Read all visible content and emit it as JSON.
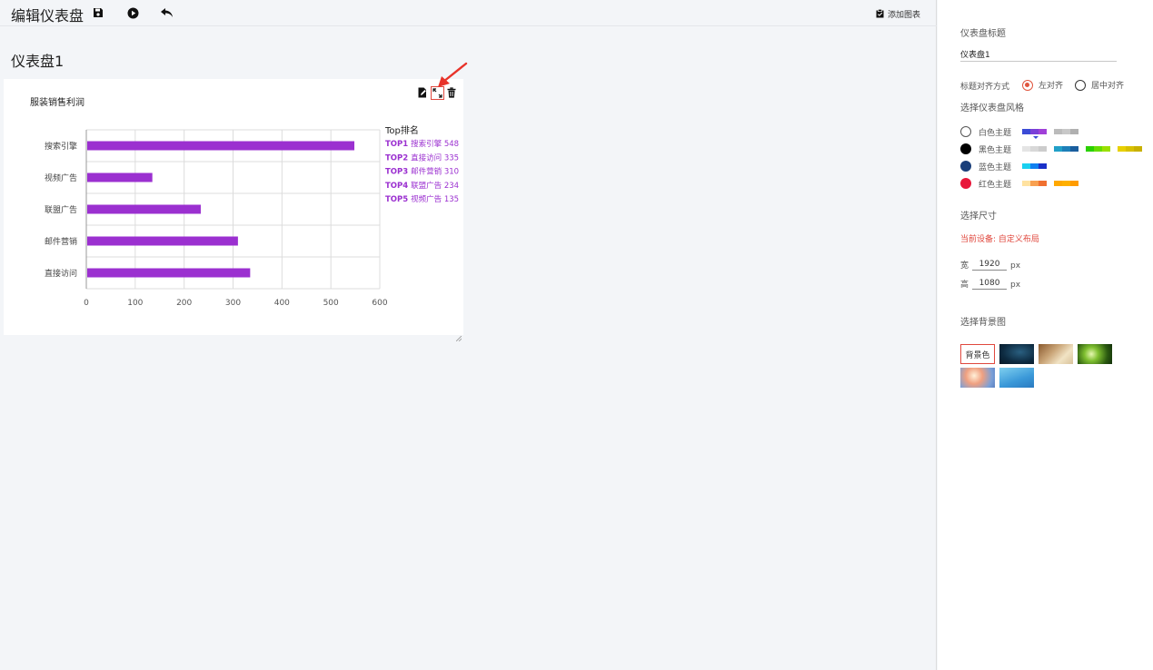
{
  "header": {
    "title": "编辑仪表盘",
    "add_chart_label": "添加图表"
  },
  "dashboard": {
    "title": "仪表盘1"
  },
  "chart_data": {
    "type": "bar",
    "orientation": "horizontal",
    "title": "服装销售利润",
    "categories": [
      "搜索引擎",
      "视频广告",
      "联盟广告",
      "邮件营销",
      "直接访问"
    ],
    "values": [
      548,
      135,
      234,
      310,
      335
    ],
    "xlim": [
      0,
      600
    ],
    "xticks": [
      0,
      100,
      200,
      300,
      400,
      500,
      600
    ],
    "grid": true,
    "bar_color": "#9b30d0",
    "legend": {
      "title": "Top排名",
      "placement": "right",
      "items": [
        {
          "rank": "TOP1",
          "text": "搜索引擎 548"
        },
        {
          "rank": "TOP2",
          "text": "直接访问 335"
        },
        {
          "rank": "TOP3",
          "text": "邮件营销 310"
        },
        {
          "rank": "TOP4",
          "text": "联盟广告 234"
        },
        {
          "rank": "TOP5",
          "text": "视频广告 135"
        }
      ]
    }
  },
  "panel": {
    "title_label": "仪表盘标题",
    "title_value": "仪表盘1",
    "align_label": "标题对齐方式",
    "align_options": [
      "左对齐",
      "居中对齐"
    ],
    "align_selected": "左对齐",
    "style_label": "选择仪表盘风格",
    "themes": [
      {
        "name": "白色主题",
        "dot": "#ffffff",
        "swatches": [
          [
            "#3b4bd6",
            "#7a3fd8",
            "#a040d8"
          ],
          [
            "#bbbbbb",
            "#c8c8c8",
            "#b0b0b0"
          ]
        ]
      },
      {
        "name": "黑色主题",
        "dot": "#000000",
        "swatches": [
          [
            "#e4e4e4",
            "#d8d8d8",
            "#cccccc"
          ],
          [
            "#22a0c8",
            "#1d7fb8",
            "#1a5e9e"
          ],
          [
            "#2bd000",
            "#66dd00",
            "#9ae000"
          ],
          [
            "#e8d000",
            "#d8c000",
            "#c8b000"
          ]
        ]
      },
      {
        "name": "蓝色主题",
        "dot": "#1a3f7a",
        "swatches": [
          [
            "#1ad0f0",
            "#1080f0",
            "#1a30c8"
          ]
        ]
      },
      {
        "name": "红色主题",
        "dot": "#e8173a",
        "swatches": [
          [
            "#ffe2a0",
            "#f8a050",
            "#f07030"
          ],
          [
            "#ffa800",
            "#ffb000",
            "#ff9c00"
          ]
        ]
      }
    ],
    "size_label": "选择尺寸",
    "device_info": "当前设备: 自定义布局",
    "width_label": "宽",
    "width_value": "1920",
    "height_label": "高",
    "height_value": "1080",
    "unit": "px",
    "bg_label": "选择背景图",
    "bg_color_button": "背景色"
  }
}
